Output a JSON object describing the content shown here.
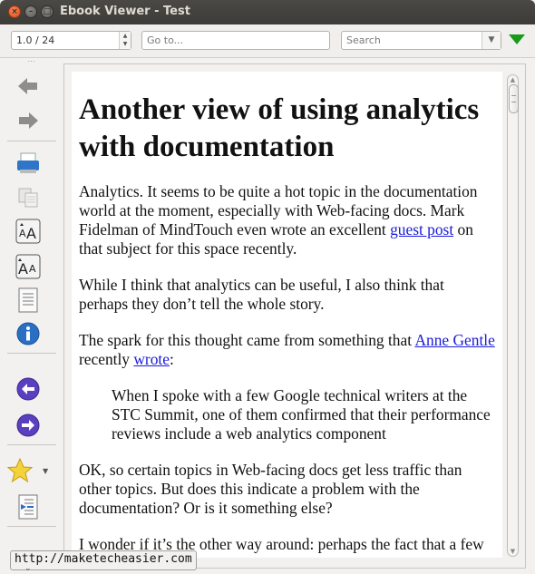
{
  "window": {
    "title": "Ebook Viewer - Test",
    "close": "×",
    "minimize": "–",
    "maximize": "□"
  },
  "toolbar": {
    "page_value": "1.0 / 24",
    "goto_placeholder": "Go to...",
    "search_placeholder": "Search",
    "dropdown_glyph": "▼",
    "spin_up": "▲",
    "spin_down": "▼"
  },
  "sidebar": {
    "icons": [
      "back-arrow-icon",
      "forward-arrow-icon",
      "print-icon",
      "copy-icon",
      "font-larger-icon",
      "font-smaller-icon",
      "table-of-contents-icon",
      "info-icon",
      "previous-page-icon",
      "next-page-icon",
      "bookmark-star-icon",
      "reference-mode-icon"
    ],
    "star_dropdown": "▼",
    "grip": "⋯"
  },
  "document": {
    "heading": "Another view of using analytics with documentation",
    "p1_before": "Analytics. It seems to be quite a hot topic in the documentation world at the moment, especially with Web-facing docs. Mark Fidelman of MindTouch even wrote an excellent ",
    "p1_link": "guest post",
    "p1_after": " on that subject for this space recently.",
    "p2": "While I think that analytics can be useful, I also think that perhaps they don’t tell the whole story.",
    "p3_before": "The spark for this thought came from something that ",
    "p3_link1": "Anne Gentle",
    "p3_mid": " recently ",
    "p3_link2": "wrote",
    "p3_after": ":",
    "quote": "When I spoke with a few Google technical writers at the STC Summit, one of them confirmed that their performance reviews include a web analytics component",
    "p4": "OK, so certain topics in Web-facing docs get less traffic than other topics. But does this indicate a problem with the documentation? Or is it something else?",
    "p5": "I wonder if it’s the other way around: perhaps the fact that a few"
  },
  "statusbar": {
    "text": "http://maketecheasier.com"
  },
  "bottom_grip": "⌄"
}
